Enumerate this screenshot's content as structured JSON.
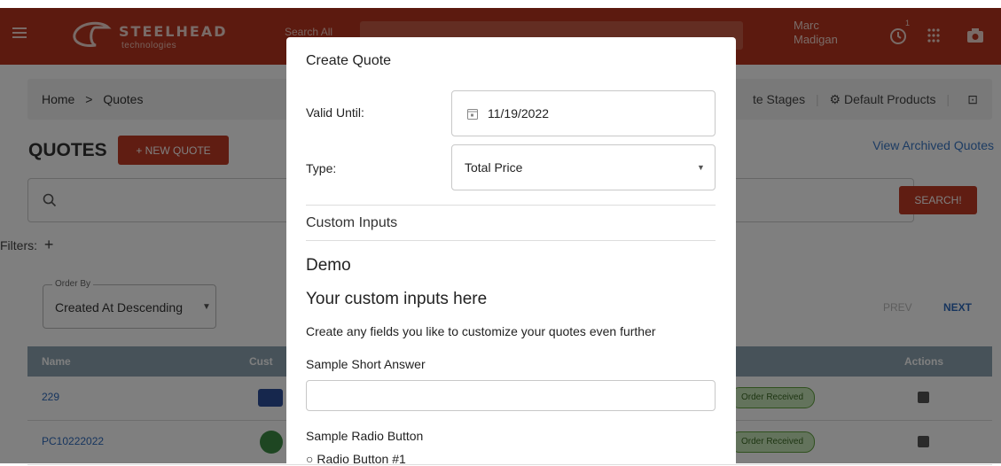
{
  "app": {
    "brand": "STEELHEAD",
    "brand_sub": "technologies",
    "search_scope": "Search All",
    "user_first": "Marc",
    "user_last": "Madigan",
    "notification_count": "1"
  },
  "breadcrumb": {
    "home": "Home",
    "sep": ">",
    "current": "Quotes",
    "stages": "te Stages",
    "default_products": "Default Products"
  },
  "page": {
    "title": "QUOTES",
    "new_button": "+ NEW QUOTE",
    "archived_link": "View Archived Quotes",
    "search_button": "SEARCH!",
    "filters_label": "Filters:"
  },
  "order_by": {
    "label": "Order By",
    "value": "Created At Descending"
  },
  "pager": {
    "prev": "PREV",
    "next": "NEXT"
  },
  "table": {
    "headers": {
      "name": "Name",
      "customer": "Cust",
      "actions": "Actions"
    },
    "rows": [
      {
        "name": "229",
        "status": "Order Received"
      },
      {
        "name": "PC10222022",
        "status": "Order Received"
      }
    ]
  },
  "modal": {
    "title": "Create Quote",
    "valid_until_label": "Valid Until:",
    "valid_until_value": "11/19/2022",
    "type_label": "Type:",
    "type_value": "Total Price",
    "custom_inputs_heading": "Custom Inputs",
    "demo_heading": "Demo",
    "custom_heading": "Your custom inputs here",
    "custom_desc": "Create any fields you like to customize your quotes even further",
    "short_answer_label": "Sample Short Answer",
    "radio_label": "Sample Radio Button",
    "radio_option_1": "Radio Button #1"
  },
  "colors": {
    "brand": "#b8351e",
    "accent_button": "#c13b25",
    "link": "#3a78c7",
    "table_header": "#8fa5b2",
    "status_pill": "#c7e6b8"
  }
}
